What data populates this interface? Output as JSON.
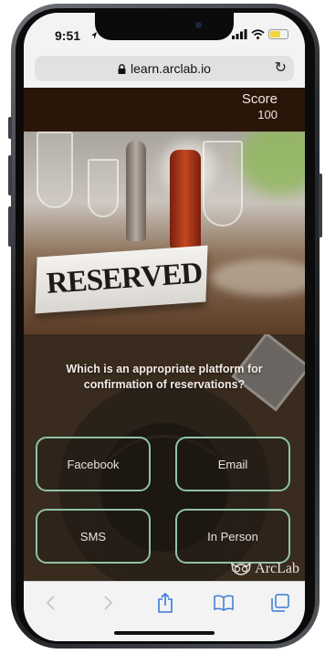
{
  "status": {
    "time": "9:51"
  },
  "browser": {
    "url": "learn.arclab.io"
  },
  "score": {
    "label": "Score",
    "value": "100"
  },
  "image": {
    "sign_text": "RESERVED"
  },
  "quiz": {
    "question": "Which is an appropriate platform for confirmation of reservations?",
    "answers": [
      "Facebook",
      "Email",
      "SMS",
      "In Person"
    ]
  },
  "brand": {
    "name": "ArcLab"
  },
  "colors": {
    "answer_border": "#8fc3a5",
    "score_bar": "#2a1509",
    "toolbar_icon": "#3a7bd5"
  },
  "toolbar": {
    "icons": [
      "back-icon",
      "forward-icon",
      "share-icon",
      "bookmarks-icon",
      "tabs-icon"
    ]
  }
}
